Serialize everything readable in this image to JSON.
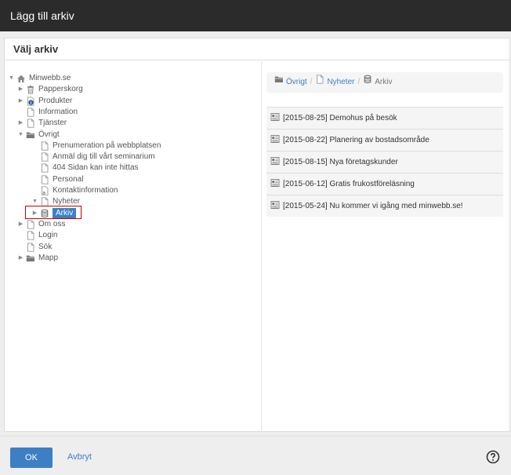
{
  "window": {
    "title": "Lägg till arkiv"
  },
  "panel": {
    "header": "Välj arkiv"
  },
  "tree": [
    {
      "label": "Minwebb.se",
      "icon": "home-icon",
      "toggle": "▼",
      "depth": 0
    },
    {
      "label": "Papperskorg",
      "icon": "trash-icon",
      "toggle": "▶",
      "depth": 1
    },
    {
      "label": "Produkter",
      "icon": "info-page-icon",
      "toggle": "▶",
      "depth": 1
    },
    {
      "label": "Information",
      "icon": "page-icon",
      "toggle": "",
      "depth": 1
    },
    {
      "label": "Tjänster",
      "icon": "page-icon",
      "toggle": "▶",
      "depth": 1
    },
    {
      "label": "Övrigt",
      "icon": "folder-icon",
      "toggle": "▼",
      "depth": 1
    },
    {
      "label": "Prenumeration på webbplatsen",
      "icon": "page-icon",
      "toggle": "",
      "depth": 2
    },
    {
      "label": "Anmäl dig till vårt seminarium",
      "icon": "page-icon",
      "toggle": "",
      "depth": 2
    },
    {
      "label": "404 Sidan kan inte hittas",
      "icon": "page-icon",
      "toggle": "",
      "depth": 2
    },
    {
      "label": "Personal",
      "icon": "page-icon",
      "toggle": "",
      "depth": 2
    },
    {
      "label": "Kontaktinformation",
      "icon": "contact-page-icon",
      "toggle": "",
      "depth": 2
    },
    {
      "label": "Nyheter",
      "icon": "page-icon",
      "toggle": "▼",
      "depth": 2
    },
    {
      "label": "Arkiv",
      "icon": "archive-icon",
      "toggle": "▶",
      "depth": 3,
      "selected": true
    },
    {
      "label": "Om oss",
      "icon": "page-icon",
      "toggle": "▶",
      "depth": 1
    },
    {
      "label": "Login",
      "icon": "page-icon",
      "toggle": "",
      "depth": 1
    },
    {
      "label": "Sök",
      "icon": "page-icon",
      "toggle": "",
      "depth": 1
    },
    {
      "label": "Mapp",
      "icon": "folder-icon",
      "toggle": "▶",
      "depth": 1
    }
  ],
  "breadcrumb": {
    "items": [
      {
        "label": "Övrigt",
        "icon": "folder-icon"
      },
      {
        "label": "Nyheter",
        "icon": "page-icon"
      }
    ],
    "separator": "/",
    "current": {
      "label": "Arkiv",
      "icon": "archive-icon"
    }
  },
  "articles": [
    "[2015-08-25] Demohus på besök",
    "[2015-08-22] Planering av bostadsområde",
    "[2015-08-15] Nya företagskunder",
    "[2015-06-12] Gratis frukostföreläsning",
    "[2015-05-24] Nu kommer vi igång med minwebb.se!"
  ],
  "footer": {
    "ok_label": "OK",
    "cancel_label": "Avbryt"
  },
  "colors": {
    "titlebar": "#2b2b2b",
    "accent": "#3d7fc4",
    "selection_border": "#cc0000"
  }
}
